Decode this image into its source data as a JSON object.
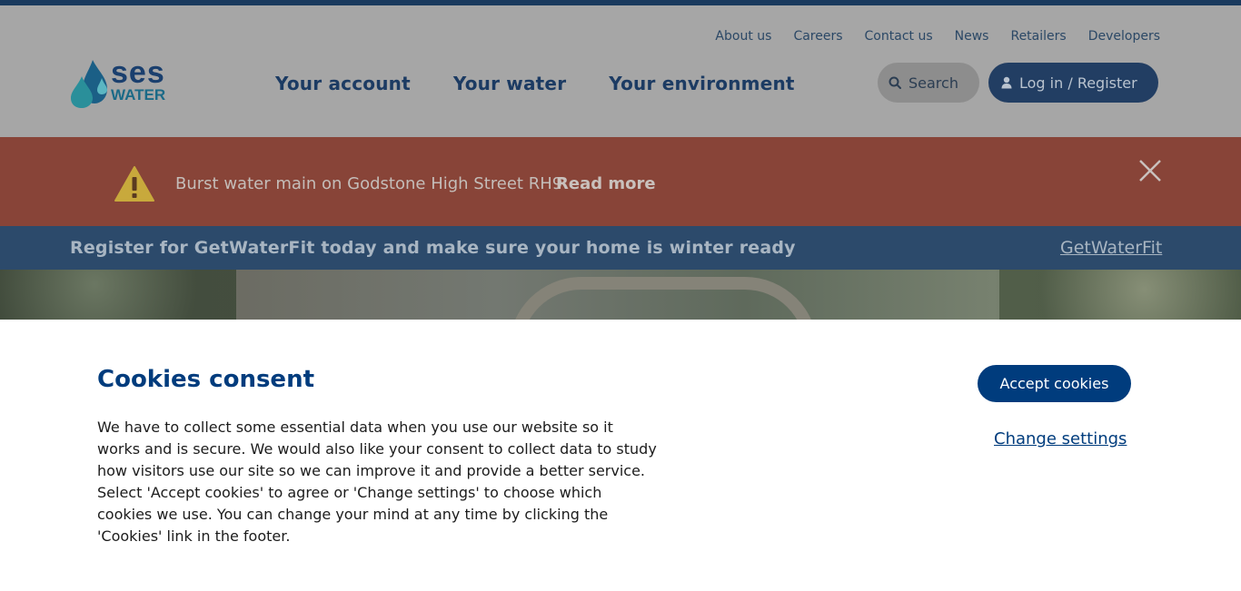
{
  "header": {
    "logo": {
      "line1": "ses",
      "line2": "WATER"
    },
    "utility_links": [
      "About us",
      "Careers",
      "Contact us",
      "News",
      "Retailers",
      "Developers"
    ],
    "main_nav": [
      "Your account",
      "Your water",
      "Your environment"
    ],
    "search_label": "Search",
    "login_label": "Log in / Register"
  },
  "alert": {
    "text": "Burst water main on Godstone High Street RH9",
    "link": "Read more"
  },
  "promo": {
    "text": "Register for GetWaterFit today and make sure your home is winter ready",
    "link": "GetWaterFit"
  },
  "cookies": {
    "title": "Cookies consent",
    "body": "We have to collect some essential data when you use our website so it works and is secure. We would also like your consent to collect data to study how visitors use our site so we can improve it and provide a better service. Select 'Accept cookies' to agree or 'Change settings' to choose which cookies we use. You can change your mind at any time by clicking the 'Cookies' link in the footer.",
    "accept_label": "Accept cookies",
    "change_label": "Change settings"
  },
  "colors": {
    "brand_navy": "#003c7d",
    "alert_bg": "#884438",
    "promo_bg": "#2c4a6b"
  },
  "icons": [
    "water-drop-logo-icon",
    "search-icon",
    "user-icon",
    "warning-icon",
    "close-icon"
  ]
}
